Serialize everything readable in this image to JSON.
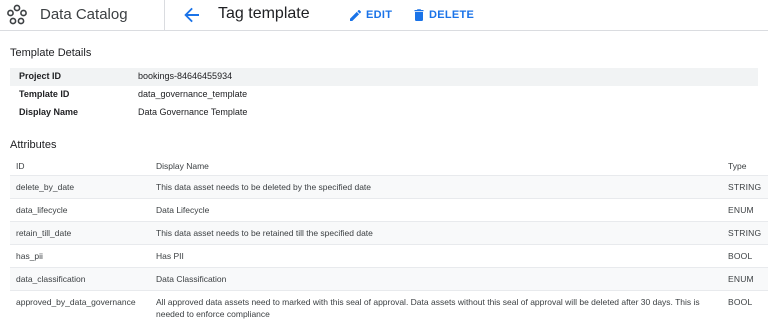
{
  "header": {
    "app_title": "Data Catalog",
    "page_title": "Tag template",
    "edit_label": "EDIT",
    "delete_label": "DELETE",
    "accent_color": "#1a73e8"
  },
  "template_details": {
    "title": "Template Details",
    "rows": [
      {
        "key": "Project ID",
        "value": "bookings-84646455934"
      },
      {
        "key": "Template ID",
        "value": "data_governance_template"
      },
      {
        "key": "Display Name",
        "value": "Data Governance Template"
      }
    ]
  },
  "attributes": {
    "title": "Attributes",
    "columns": {
      "id": "ID",
      "name": "Display Name",
      "type": "Type"
    },
    "rows": [
      {
        "id": "delete_by_date",
        "name": "This data asset needs to be deleted by the specified date",
        "type": "STRING"
      },
      {
        "id": "data_lifecycle",
        "name": "Data Lifecycle",
        "type": "ENUM"
      },
      {
        "id": "retain_till_date",
        "name": "This data asset needs to be retained till the specified date",
        "type": "STRING"
      },
      {
        "id": "has_pii",
        "name": "Has PII",
        "type": "BOOL"
      },
      {
        "id": "data_classification",
        "name": "Data Classification",
        "type": "ENUM"
      },
      {
        "id": "approved_by_data_governance",
        "name": "All approved data assets need to marked with this seal of approval. Data assets without this seal of approval will be deleted after 30 days. This is needed to enforce compliance",
        "type": "BOOL"
      }
    ]
  }
}
